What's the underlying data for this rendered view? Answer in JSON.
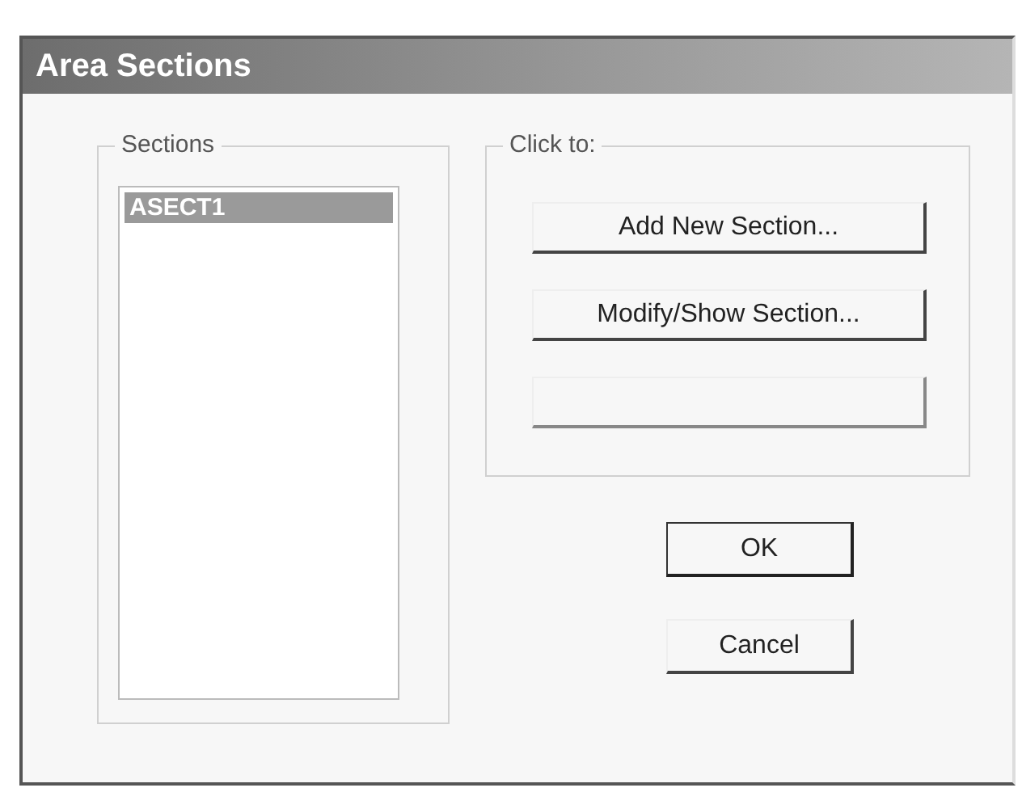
{
  "window": {
    "title": "Area Sections"
  },
  "sections": {
    "label": "Sections",
    "items": [
      {
        "label": "ASECT1",
        "selected": true
      }
    ]
  },
  "actions": {
    "label": "Click to:",
    "buttons": [
      {
        "label": "Add New Section...",
        "disabled": false
      },
      {
        "label": "Modify/Show Section...",
        "disabled": false
      },
      {
        "disabled": true
      }
    ]
  },
  "buttons": [
    {
      "label": "OK"
    },
    {
      "label": "Cancel"
    }
  ]
}
